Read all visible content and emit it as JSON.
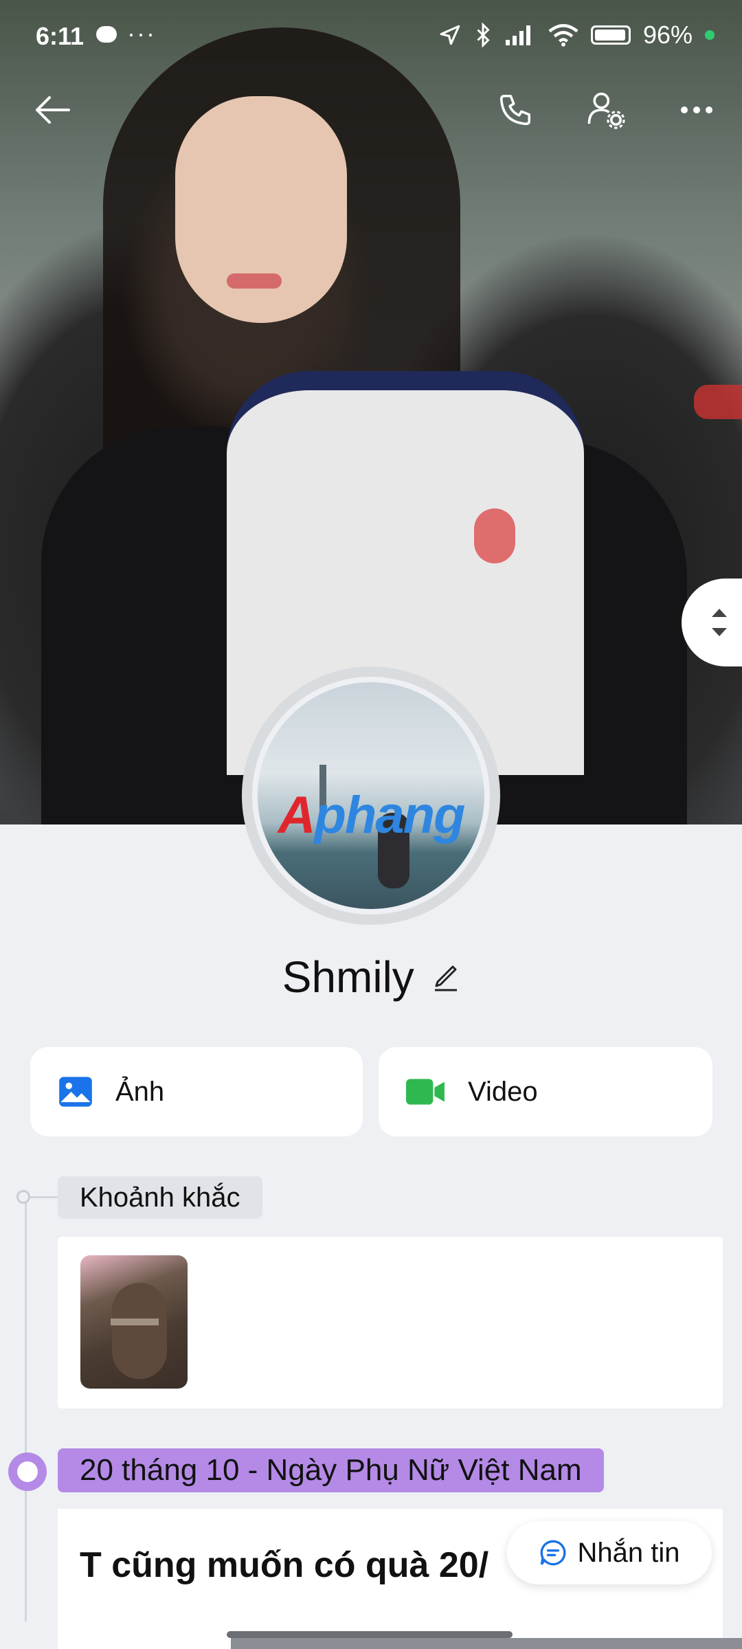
{
  "status_bar": {
    "time": "6:11",
    "more": "···",
    "battery_pct": "96%"
  },
  "profile": {
    "name": "Shmily",
    "avatar_watermark": "Aphang"
  },
  "media_buttons": {
    "photos": "Ảnh",
    "videos": "Video"
  },
  "timeline": {
    "moments_label": "Khoảnh khắc",
    "event_label": "20 tháng 10 - Ngày Phụ Nữ Việt Nam",
    "post_text": "T cũng muốn có quà 20/"
  },
  "actions": {
    "message": "Nhắn tin"
  },
  "colors": {
    "accent_purple": "#b48ae6",
    "photo_icon_blue": "#1a73e8",
    "video_icon_green": "#2fb84f",
    "background": "#eef0f4"
  },
  "icons": [
    "back-arrow-icon",
    "phone-icon",
    "user-settings-icon",
    "more-icon",
    "edit-pencil-icon",
    "photo-icon",
    "video-camera-icon",
    "chat-icon",
    "scroll-arrows-icon"
  ]
}
